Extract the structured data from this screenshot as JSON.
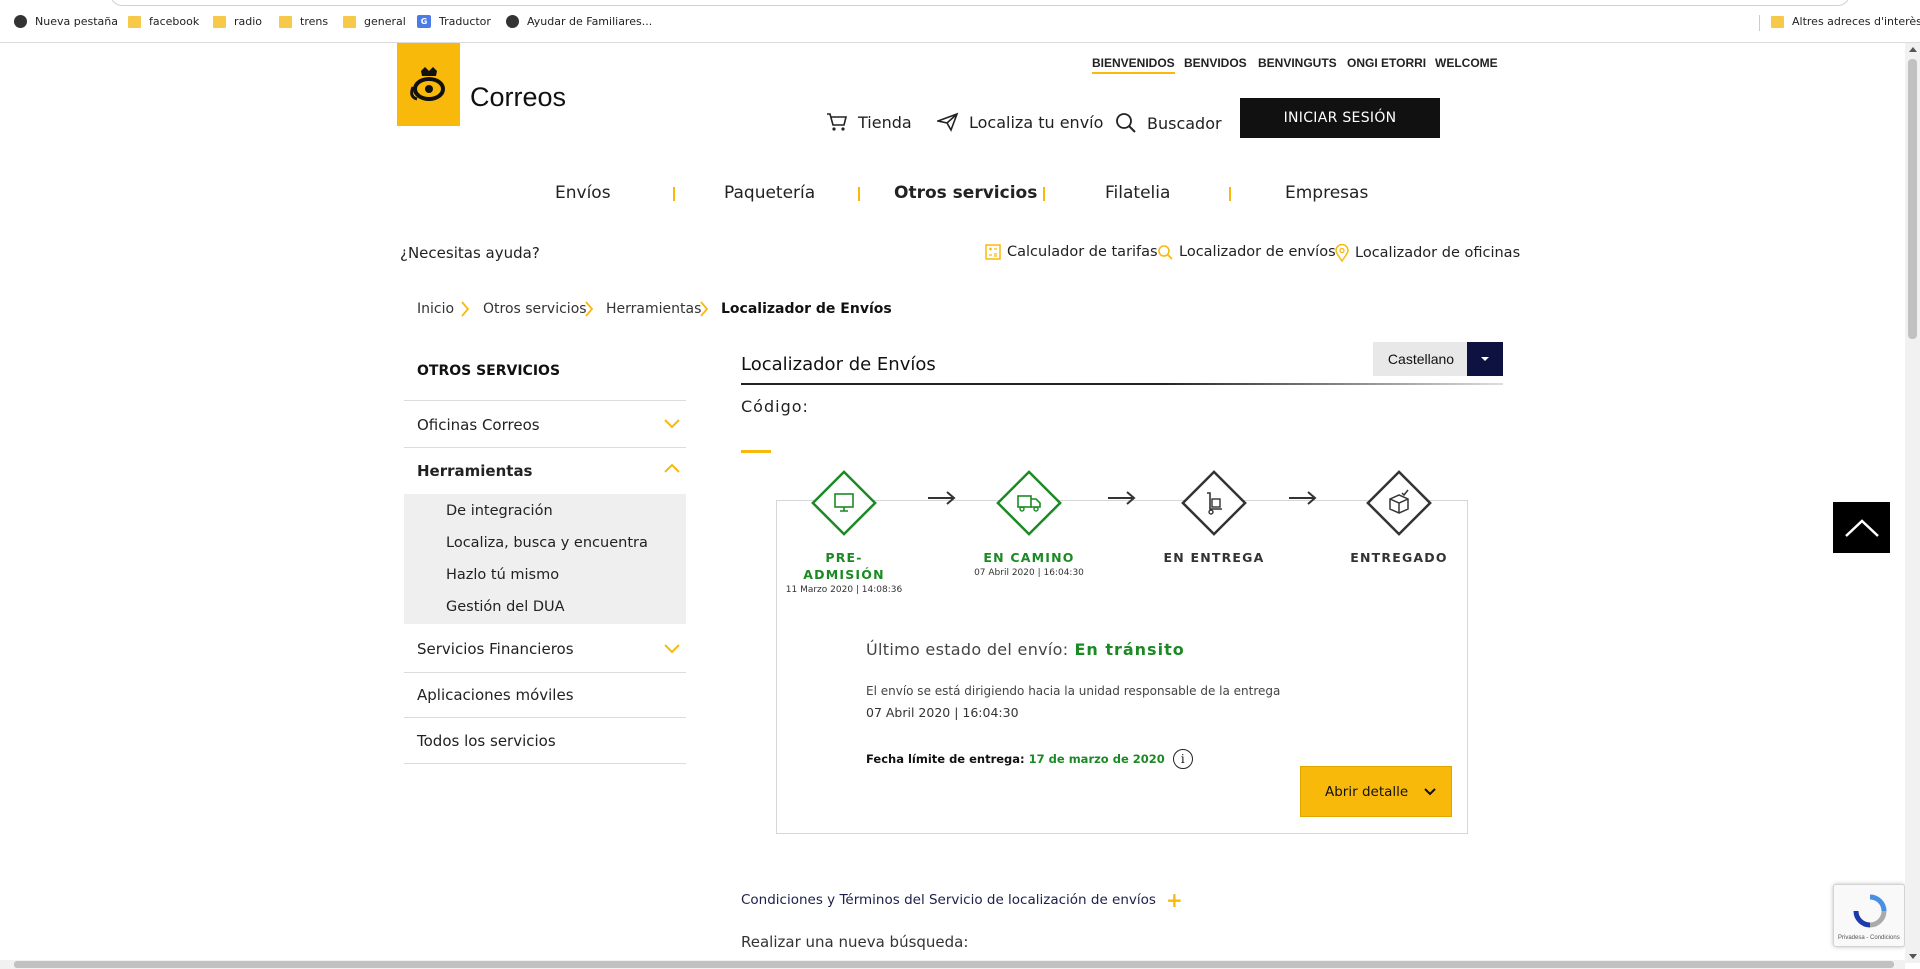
{
  "bookmarks": {
    "items": [
      {
        "label": "Nueva pestaña",
        "icon": "globe-icon"
      },
      {
        "label": "facebook",
        "icon": "folder-icon"
      },
      {
        "label": "radio",
        "icon": "folder-icon"
      },
      {
        "label": "trens",
        "icon": "folder-icon"
      },
      {
        "label": "general",
        "icon": "folder-icon"
      },
      {
        "label": "Traductor",
        "icon": "translate-icon"
      },
      {
        "label": "Ayudar de Familiares...",
        "icon": "globe-icon"
      }
    ],
    "other": "Altres adreces d'interès"
  },
  "header": {
    "logo_text": "Correos",
    "languages": [
      "BIENVENIDOS",
      "BENVIDOS",
      "BENVINGUTS",
      "ONGI ETORRI",
      "WELCOME"
    ],
    "tools": {
      "tienda": "Tienda",
      "localiza": "Localiza tu envío",
      "buscador": "Buscador"
    },
    "login": "INICIAR SESIÓN"
  },
  "mainnav": [
    "Envíos",
    "Paquetería",
    "Otros servicios",
    "Filatelia",
    "Empresas"
  ],
  "helpbar": {
    "question": "¿Necesitas ayuda?",
    "links": [
      "Calculador de tarifas",
      "Localizador de envíos",
      "Localizador de oficinas"
    ]
  },
  "breadcrumb": [
    "Inicio",
    "Otros servicios",
    "Herramientas",
    "Localizador de Envíos"
  ],
  "sidebar": {
    "title": "OTROS SERVICIOS",
    "items": [
      "Oficinas Correos",
      "Herramientas",
      "Servicios Financieros",
      "Aplicaciones móviles",
      "Todos los servicios"
    ],
    "subitems": [
      "De integración",
      "Localiza, busca y encuentra",
      "Hazlo tú mismo",
      "Gestión del DUA"
    ]
  },
  "main": {
    "title": "Localizador de Envíos",
    "language": "Castellano",
    "codigo_label": "Código:",
    "steps": [
      {
        "label": "PRE-\nADMISIÓN",
        "l1": "PRE-",
        "l2": "ADMISIÓN",
        "date": "11 Marzo 2020 | 14:08:36",
        "status": "done",
        "icon": "monitor-icon"
      },
      {
        "label": "EN CAMINO",
        "l1": "EN CAMINO",
        "l2": "",
        "date": "07 Abril 2020 | 16:04:30",
        "status": "done",
        "icon": "truck-icon"
      },
      {
        "label": "EN ENTREGA",
        "l1": "EN ENTREGA",
        "l2": "",
        "date": "",
        "status": "todo",
        "icon": "hand-truck-icon"
      },
      {
        "label": "ENTREGADO",
        "l1": "ENTREGADO",
        "l2": "",
        "date": "",
        "status": "todo",
        "icon": "box-check-icon"
      }
    ],
    "estado_label": "Último estado del envío:",
    "estado_value": "En tránsito",
    "description": "El envío se está dirigiendo hacia la unidad responsable de la entrega",
    "description_date": "07 Abril 2020 | 16:04:30",
    "fecha_label": "Fecha límite de entrega:",
    "fecha_value": "17 de marzo de 2020",
    "detalle_button": "Abrir detalle",
    "conditions": "Condiciones y Términos del Servicio de localización de envíos",
    "nueva_busqueda": "Realizar una nueva búsqueda:"
  },
  "recaptcha": {
    "text": "Privadesa - Condicions"
  },
  "colors": {
    "brand_yellow": "#f9b90b",
    "status_green": "#1b8a24",
    "dark_navy": "#0d1240"
  }
}
